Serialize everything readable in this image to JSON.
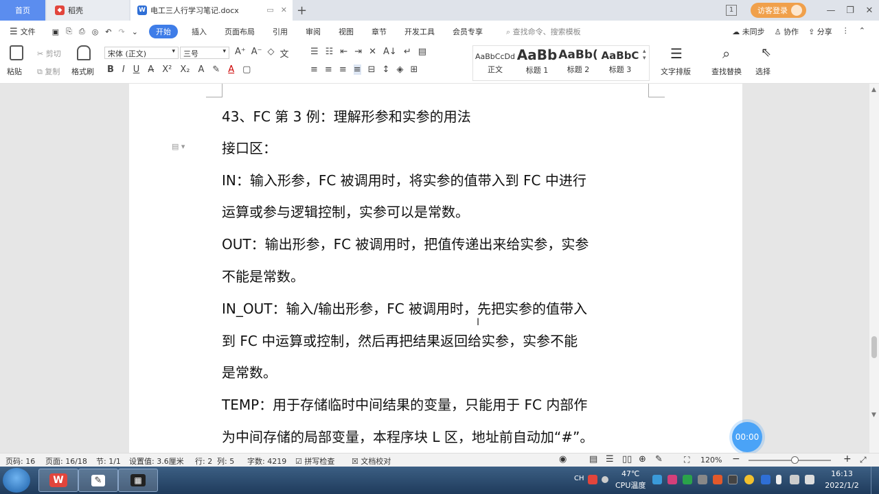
{
  "tabs": {
    "home": "首页",
    "daoke": "稻壳",
    "doc": "电工三人行学习笔记.docx",
    "add": "+"
  },
  "titlebar": {
    "login": "访客登录",
    "window_controls": [
      "1",
      "—",
      "❐",
      "✕"
    ]
  },
  "menu": {
    "file": "文件",
    "items": [
      "开始",
      "插入",
      "页面布局",
      "引用",
      "审阅",
      "视图",
      "章节",
      "开发工具",
      "会员专享"
    ],
    "search": "查找命令、搜索模板",
    "sync": "未同步",
    "collab": "协作",
    "share": "分享"
  },
  "ribbon": {
    "paste": "粘贴",
    "cut": "剪切",
    "copy": "复制",
    "format_painter": "格式刷",
    "font_name": "宋体 (正文)",
    "font_size": "三号",
    "styles": [
      {
        "sample": "AaBbCcDd",
        "label": "正文"
      },
      {
        "sample": "AaBb",
        "label": "标题 1"
      },
      {
        "sample": "AaBb(",
        "label": "标题 2"
      },
      {
        "sample": "AaBbC",
        "label": "标题 3"
      }
    ],
    "text_layout": "文字排版",
    "find_replace": "查找替换",
    "select": "选择"
  },
  "document": {
    "heading": "43、FC 第 3 例：理解形参和实参的用法",
    "lines": [
      "接口区：",
      "IN：输入形参，FC 被调用时，将实参的值带入到 FC 中进行",
      "运算或参与逻辑控制，实参可以是常数。",
      "OUT：输出形参，FC 被调用时，把值传递出来给实参，实参",
      "不能是常数。",
      "IN_OUT：输入/输出形参，FC 被调用时，先把实参的值带入",
      "到 FC 中运算或控制，然后再把结果返回给实参，实参不能",
      "是常数。",
      "TEMP：用于存储临时中间结果的变量，只能用于 FC 内部作",
      "为中间存储的局部变量，本程序块 L 区，地址前自动加“#”。"
    ]
  },
  "timer": "00:00",
  "status": {
    "page_num": "页码: 16",
    "page": "页面: 16/18",
    "section": "节: 1/1",
    "setting": "设置值: 3.6厘米",
    "row": "行: 2",
    "col": "列: 5",
    "word_count": "字数: 4219",
    "spell_check": "拼写检查",
    "doc_check": "文档校对",
    "zoom": "120%",
    "zoom_level_percent": 120
  },
  "taskbar": {
    "lang": "CH",
    "cpu_temp": "47℃",
    "cpu_label": "CPU温度",
    "time": "16:13",
    "date": "2022/1/2"
  }
}
